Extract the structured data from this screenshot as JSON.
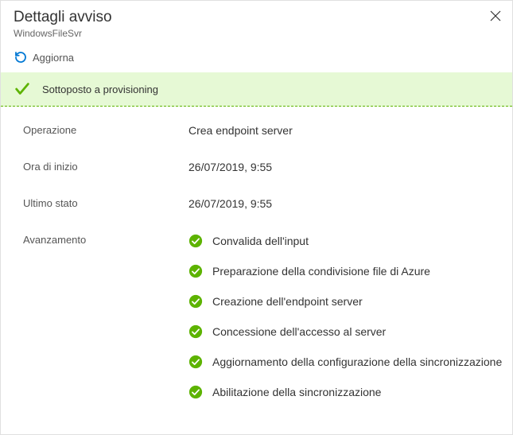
{
  "header": {
    "title": "Dettagli avviso",
    "subtitle": "WindowsFileSvr"
  },
  "toolbar": {
    "refresh_label": "Aggiorna"
  },
  "status": {
    "text": "Sottoposto a provisioning"
  },
  "labels": {
    "operation": "Operazione",
    "start_time": "Ora di inizio",
    "last_state": "Ultimo stato",
    "progress": "Avanzamento"
  },
  "values": {
    "operation": "Crea endpoint server",
    "start_time": "26/07/2019, 9:55",
    "last_state": "26/07/2019, 9:55"
  },
  "steps": [
    "Convalida dell'input",
    "Preparazione della condivisione file di Azure",
    "Creazione dell'endpoint server",
    "Concessione dell'accesso al server",
    "Aggiornamento della configurazione della sincronizzazione",
    "Abilitazione della sincronizzazione"
  ]
}
